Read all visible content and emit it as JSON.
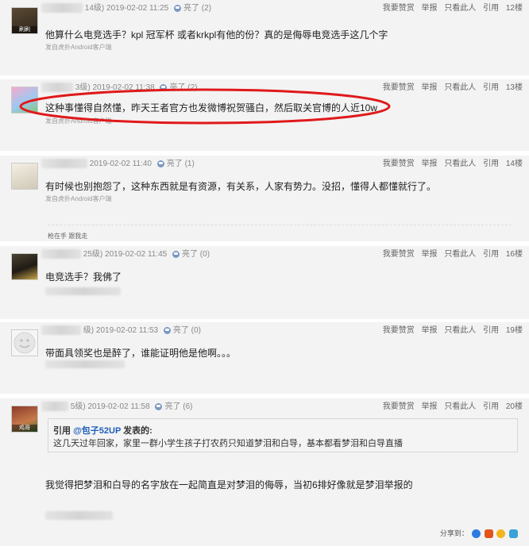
{
  "ops": {
    "praise": "我要赞赏",
    "report": "举报",
    "only_this": "只看此人",
    "quote": "引用"
  },
  "light_label": "亮了",
  "posts": [
    {
      "avatar_label": "刷刷",
      "meta_a": "14级) 2019-02-02 11:25",
      "lights": "(2)",
      "floor": "12楼",
      "content": "他算什么电竞选手？kpl 冠军杯 或者krkpl有他的份？真的是侮辱电竞选手这几个字",
      "device": "发自虎扑Android客户端"
    },
    {
      "avatar_label": "",
      "meta_a": "3级) 2019-02-02 11:38",
      "lights": "(2)",
      "floor": "13楼",
      "content": "这种事懂得自然懂，昨天王者官方也发微博祝贺骚白，然后取关官博的人近10w",
      "device": "发自虎扑Android客户端"
    },
    {
      "avatar_label": "",
      "meta_a": "2019-02-02 11:40",
      "lights": "(1)",
      "floor": "14楼",
      "content": "有时候也别抱怨了，这种东西就是有资源，有关系，人家有势力。没招，懂得人都懂就行了。",
      "device": "发自虎扑Android客户端",
      "links": "枪在手 跟我走"
    },
    {
      "avatar_label": "",
      "meta_a": "25级) 2019-02-02 11:45",
      "lights": "(0)",
      "floor": "16楼",
      "content": "电竞选手？我佛了"
    },
    {
      "avatar_label": "",
      "meta_a": "级) 2019-02-02 11:53",
      "lights": "(0)",
      "floor": "19楼",
      "content": "带面具领奖也是醉了，谁能证明他是他啊。。。"
    },
    {
      "avatar_label": "鸡哥",
      "meta_a": "5级) 2019-02-02 11:58",
      "lights": "(6)",
      "floor": "20楼",
      "quote_prefix": "引用 ",
      "quote_user": "@包子52UP",
      "quote_suffix": " 发表的:",
      "quote_text": "这几天过年回家，家里一群小学生孩子打农药只知道梦泪和白导，基本都看梦泪和白导直播",
      "content": "我觉得把梦泪和白导的名字放在一起简直是对梦泪的侮辱，当初6排好像就是梦泪举报的",
      "share_label": "分享到："
    }
  ]
}
